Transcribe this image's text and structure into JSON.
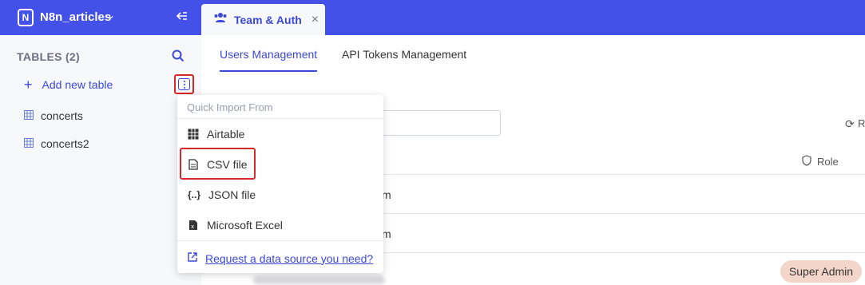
{
  "sidebar": {
    "project_name": "N8n_articles",
    "logo_letter": "N",
    "tables_header": "TABLES (2)",
    "add_table_label": "Add new table",
    "tables": [
      {
        "label": "concerts"
      },
      {
        "label": "concerts2"
      }
    ]
  },
  "tabbar": {
    "active_tab_label": "Team & Auth",
    "close_glyph": "×"
  },
  "main": {
    "subtabs": [
      {
        "label": "Users Management",
        "active": true
      },
      {
        "label": "API Tokens Management",
        "active": false
      }
    ],
    "reload_partial": "R",
    "role_header": "Role",
    "rows": [
      {
        "email_suffix": "m"
      },
      {
        "email_suffix": "m"
      }
    ],
    "badge": "Super Admin"
  },
  "dropdown": {
    "header": "Quick Import From",
    "items": [
      {
        "label": "Airtable",
        "icon": "table-grid-icon"
      },
      {
        "label": "CSV file",
        "icon": "file-text-icon"
      },
      {
        "label": "JSON file",
        "icon": "json-braces-icon"
      },
      {
        "label": "Microsoft Excel",
        "icon": "excel-icon"
      }
    ],
    "request_link": "Request a data source you need?"
  },
  "colors": {
    "brand": "#4351e8",
    "accent": "#3b48d9",
    "highlight_border": "#d92828",
    "badge_bg": "#f3d6c9"
  }
}
